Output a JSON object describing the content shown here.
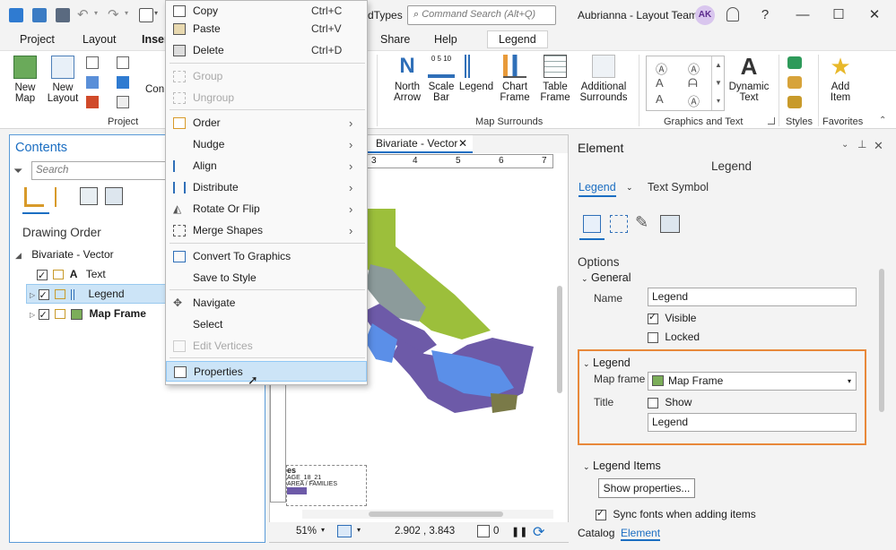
{
  "titlebar": {
    "doc_fragment": "dTypes",
    "search_placeholder": "Command Search (Alt+Q)",
    "window_title": "Aubrianna - Layout Team",
    "avatar_initials": "AK",
    "help": "?",
    "minimize": "—",
    "maximize": "☐",
    "close": "✕"
  },
  "tabs": {
    "project": "Project",
    "layout": "Layout",
    "insert": "Inser",
    "share": "Share",
    "help": "Help",
    "legend_ctx": "Legend"
  },
  "ribbon": {
    "project_group": {
      "new_map": "New Map",
      "new_layout": "New Layout",
      "con": "Con",
      "label": "Project"
    },
    "map_surrounds": {
      "north_arrow": "North Arrow",
      "scale_bar": "Scale Bar",
      "legend": "Legend",
      "chart_frame": "Chart Frame",
      "table_frame": "Table Frame",
      "additional_surrounds": "Additional Surrounds",
      "label": "Map Surrounds",
      "scale_digits": "0 5 10"
    },
    "graphics_text": {
      "dynamic_text": "Dynamic Text",
      "label": "Graphics and Text"
    },
    "styles": {
      "label": "Styles"
    },
    "favorites": {
      "add_item": "Add Item",
      "label": "Favorites"
    }
  },
  "contents": {
    "title": "Contents",
    "search_placeholder": "Search",
    "drawing_order": "Drawing Order",
    "root": "Bivariate - Vector",
    "items": [
      {
        "label": "Text",
        "checked": true
      },
      {
        "label": "Legend",
        "checked": true
      },
      {
        "label": "Map Frame",
        "checked": true
      }
    ]
  },
  "context_menu": {
    "items": [
      {
        "label": "Copy",
        "shortcut": "Ctrl+C",
        "enabled": true
      },
      {
        "label": "Paste",
        "shortcut": "Ctrl+V",
        "enabled": true
      },
      {
        "label": "Delete",
        "shortcut": "Ctrl+D",
        "enabled": true
      },
      {
        "label": "Group",
        "enabled": false
      },
      {
        "label": "Ungroup",
        "enabled": false
      },
      {
        "label": "Order",
        "submenu": true,
        "enabled": true
      },
      {
        "label": "Nudge",
        "submenu": true,
        "enabled": true
      },
      {
        "label": "Align",
        "submenu": true,
        "enabled": true
      },
      {
        "label": "Distribute",
        "submenu": true,
        "enabled": true
      },
      {
        "label": "Rotate Or Flip",
        "submenu": true,
        "enabled": true
      },
      {
        "label": "Merge Shapes",
        "submenu": true,
        "enabled": true
      },
      {
        "label": "Convert To Graphics",
        "enabled": true
      },
      {
        "label": "Save to Style",
        "enabled": true
      },
      {
        "label": "Navigate",
        "enabled": true
      },
      {
        "label": "Select",
        "enabled": true
      },
      {
        "label": "Edit Vertices",
        "enabled": false
      },
      {
        "label": "Properties",
        "enabled": true,
        "hover": true
      }
    ]
  },
  "view": {
    "tab_title": "Bivariate - Vector",
    "ruler_numbers": [
      "3",
      "4",
      "5",
      "6",
      "7"
    ],
    "legend_preview_title": "es",
    "legend_preview_line1": "AGE_18_21",
    "legend_preview_line2": "AREA / FAMILIES",
    "zoom": "51%",
    "coords": "2.902 , 3.843",
    "selection_count": "0",
    "pause": "❚❚",
    "refresh": "⟳"
  },
  "element_pane": {
    "title": "Element",
    "subtitle": "Legend",
    "tabs": [
      "Legend",
      "Text Symbol"
    ],
    "options": "Options",
    "general": "General",
    "name_label": "Name",
    "name_value": "Legend",
    "visible_label": "Visible",
    "visible": true,
    "locked_label": "Locked",
    "locked": false,
    "legend_section": "Legend",
    "map_frame_label": "Map frame",
    "map_frame_value": "Map Frame",
    "title_label": "Title",
    "show_label": "Show",
    "show": false,
    "title_value": "Legend",
    "legend_items": "Legend Items",
    "show_properties": "Show properties...",
    "sync_fonts": "Sync fonts when adding items",
    "sync": true
  },
  "bottom_tabs": {
    "catalog": "Catalog",
    "element": "Element"
  },
  "colors": {
    "accent": "#1b6ec2",
    "highlight_border": "#e8883a",
    "menu_hover": "#cce4f7",
    "map_green": "#9cbf3b",
    "map_blue": "#5b8fe8",
    "map_purple": "#6d5aa8",
    "map_gray": "#8c9b9b"
  }
}
